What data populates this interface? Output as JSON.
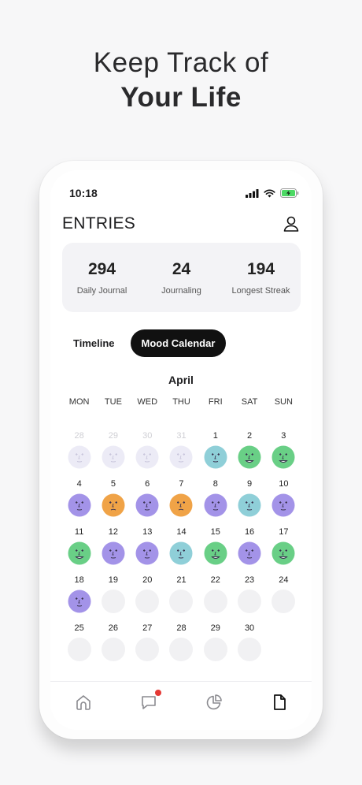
{
  "headline": {
    "line1": "Keep Track of",
    "line2": "Your Life"
  },
  "status_bar": {
    "time": "10:18"
  },
  "page": {
    "title": "ENTRIES"
  },
  "stats": [
    {
      "value": "294",
      "label": "Daily Journal"
    },
    {
      "value": "24",
      "label": "Journaling"
    },
    {
      "value": "194",
      "label": "Longest Streak"
    }
  ],
  "tabs": [
    {
      "label": "Timeline",
      "active": false
    },
    {
      "label": "Mood Calendar",
      "active": true
    }
  ],
  "calendar": {
    "month": "April",
    "weekdays": [
      "MON",
      "TUE",
      "WED",
      "THU",
      "FRI",
      "SAT",
      "SUN"
    ],
    "weeks": [
      [
        {
          "day": "28",
          "mood": "faded"
        },
        {
          "day": "29",
          "mood": "faded"
        },
        {
          "day": "30",
          "mood": "faded"
        },
        {
          "day": "31",
          "mood": "faded"
        },
        {
          "day": "1",
          "mood": "blue"
        },
        {
          "day": "2",
          "mood": "green"
        },
        {
          "day": "3",
          "mood": "green"
        }
      ],
      [
        {
          "day": "4",
          "mood": "purple"
        },
        {
          "day": "5",
          "mood": "orange"
        },
        {
          "day": "6",
          "mood": "purple"
        },
        {
          "day": "7",
          "mood": "orange"
        },
        {
          "day": "8",
          "mood": "purple"
        },
        {
          "day": "9",
          "mood": "blue"
        },
        {
          "day": "10",
          "mood": "purple"
        }
      ],
      [
        {
          "day": "11",
          "mood": "green"
        },
        {
          "day": "12",
          "mood": "purple"
        },
        {
          "day": "13",
          "mood": "purple"
        },
        {
          "day": "14",
          "mood": "blue"
        },
        {
          "day": "15",
          "mood": "green"
        },
        {
          "day": "16",
          "mood": "purple"
        },
        {
          "day": "17",
          "mood": "green"
        }
      ],
      [
        {
          "day": "18",
          "mood": "purple"
        },
        {
          "day": "19",
          "mood": "empty"
        },
        {
          "day": "20",
          "mood": "empty"
        },
        {
          "day": "21",
          "mood": "empty"
        },
        {
          "day": "22",
          "mood": "empty"
        },
        {
          "day": "23",
          "mood": "empty"
        },
        {
          "day": "24",
          "mood": "empty"
        }
      ],
      [
        {
          "day": "25",
          "mood": "empty"
        },
        {
          "day": "26",
          "mood": "empty"
        },
        {
          "day": "27",
          "mood": "empty"
        },
        {
          "day": "28",
          "mood": "empty"
        },
        {
          "day": "29",
          "mood": "empty"
        },
        {
          "day": "30",
          "mood": "empty"
        },
        {
          "day": "",
          "mood": "none"
        }
      ]
    ]
  },
  "mood_colors": {
    "purple": "#a393e8",
    "orange": "#f0a347",
    "green": "#69cf86",
    "blue": "#8fcfd8",
    "faded": "#ecebf6"
  },
  "tab_bar": [
    {
      "icon": "home-icon",
      "active": false,
      "badge": false
    },
    {
      "icon": "chat-icon",
      "active": false,
      "badge": true
    },
    {
      "icon": "pie-chart-icon",
      "active": false,
      "badge": false
    },
    {
      "icon": "document-icon",
      "active": true,
      "badge": false
    }
  ],
  "colors": {
    "badge": "#e53935",
    "active_tab_bg": "#111111",
    "stats_bg": "#f3f3f6"
  }
}
